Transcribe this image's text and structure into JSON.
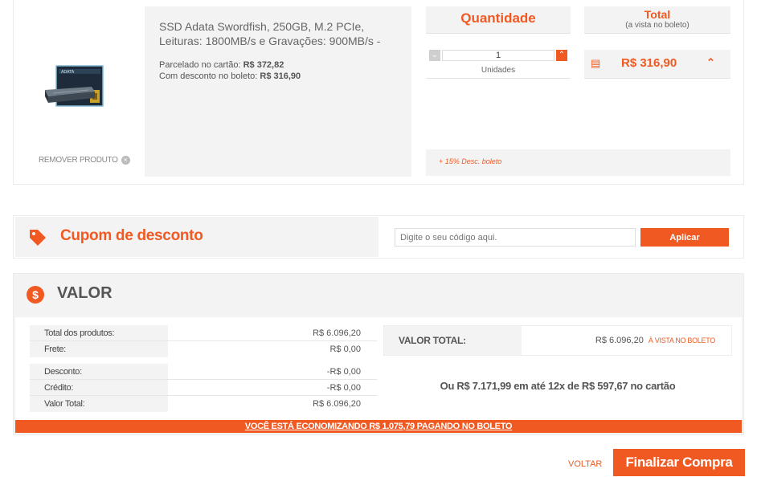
{
  "product": {
    "remove_label": "REMOVER PRODUTO",
    "name_line1": "SSD Adata Swordfish, 250GB, M.2 PCIe,",
    "name_line2": "Leituras: 1800MB/s e Gravações: 900MB/s -",
    "installment_label": "Parcelado no cartão:",
    "installment_value": "R$  372,82",
    "discount_label": "Com desconto no boleto:",
    "discount_value": "R$  316,90"
  },
  "quantity": {
    "header": "Quantidade",
    "value": "1",
    "unit_label": "Unidades"
  },
  "total": {
    "header": "Total",
    "subheader": "(a vista no boleto)",
    "value": "R$  316,90"
  },
  "promo_text": "+ 15% Desc. boleto",
  "coupon": {
    "title": "Cupom de desconto",
    "placeholder": "Digite o seu código aqui.",
    "apply_label": "Aplicar"
  },
  "valor": {
    "title": "VALOR",
    "rows_top": [
      {
        "label": "Total dos produtos:",
        "value": "R$  6.096,20"
      },
      {
        "label": "Frete:",
        "value": "R$  0,00"
      }
    ],
    "rows_bottom": [
      {
        "label": "Desconto:",
        "value": "-R$  0,00"
      },
      {
        "label": "Crédito:",
        "value": "-R$  0,00"
      },
      {
        "label": "Valor Total:",
        "value": "R$  6.096,20"
      }
    ],
    "total_label": "VALOR TOTAL:",
    "total_value": "R$  6.096,20",
    "total_note": "À VISTA NO BOLETO",
    "card_offer": "Ou R$  7.171,99 em até 12x de R$  597,67 no cartão",
    "savings_banner": "VOCÊ ESTÁ ECONOMIZANDO R$  1.075,79 PAGANDO NO BOLETO"
  },
  "actions": {
    "back_label": "VOLTAR",
    "finish_label": "Finalizar Compra"
  },
  "colors": {
    "accent": "#f05a22",
    "panel": "#f3f3f3"
  }
}
